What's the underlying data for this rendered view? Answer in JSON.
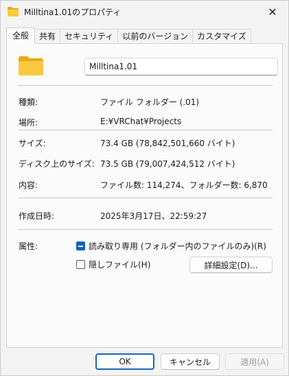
{
  "window": {
    "title": "Milltina1.01のプロパティ",
    "close_glyph": "✕"
  },
  "tabs": [
    {
      "label": "全般",
      "active": true
    },
    {
      "label": "共有"
    },
    {
      "label": "セキュリティ"
    },
    {
      "label": "以前のバージョン"
    },
    {
      "label": "カスタマイズ"
    }
  ],
  "general": {
    "name_value": "Milltina1.01",
    "rows": {
      "type": {
        "label": "種類:",
        "value": "ファイル フォルダー (.01)"
      },
      "location": {
        "label": "場所:",
        "value": "E:¥VRChat¥Projects"
      },
      "size": {
        "label": "サイズ:",
        "value": "73.4 GB (78,842,501,660 バイト)"
      },
      "disk_size": {
        "label": "ディスク上のサイズ:",
        "value": "73.5 GB (79,007,424,512 バイト)"
      },
      "contents": {
        "label": "内容:",
        "value": "ファイル数: 114,274、フォルダー数: 6,870"
      },
      "created": {
        "label": "作成日時:",
        "value": "2025年3月17日、22:59:27"
      }
    },
    "attributes": {
      "label": "属性:",
      "read_only": {
        "label": "読み取り専用 (フォルダー内のファイルのみ)(R)",
        "state": "indeterminate"
      },
      "hidden": {
        "label": "隠しファイル(H)",
        "state": "unchecked"
      },
      "advanced_button": "詳細設定(D)..."
    }
  },
  "buttons": {
    "ok": "OK",
    "cancel": "キャンセル",
    "apply": "適用(A)"
  },
  "icons": {
    "title": "folder-icon",
    "large": "folder-icon"
  },
  "colors": {
    "accent": "#0f62b5",
    "folder_yellow": "#f8c940",
    "folder_yellow_dark": "#e8a917"
  }
}
